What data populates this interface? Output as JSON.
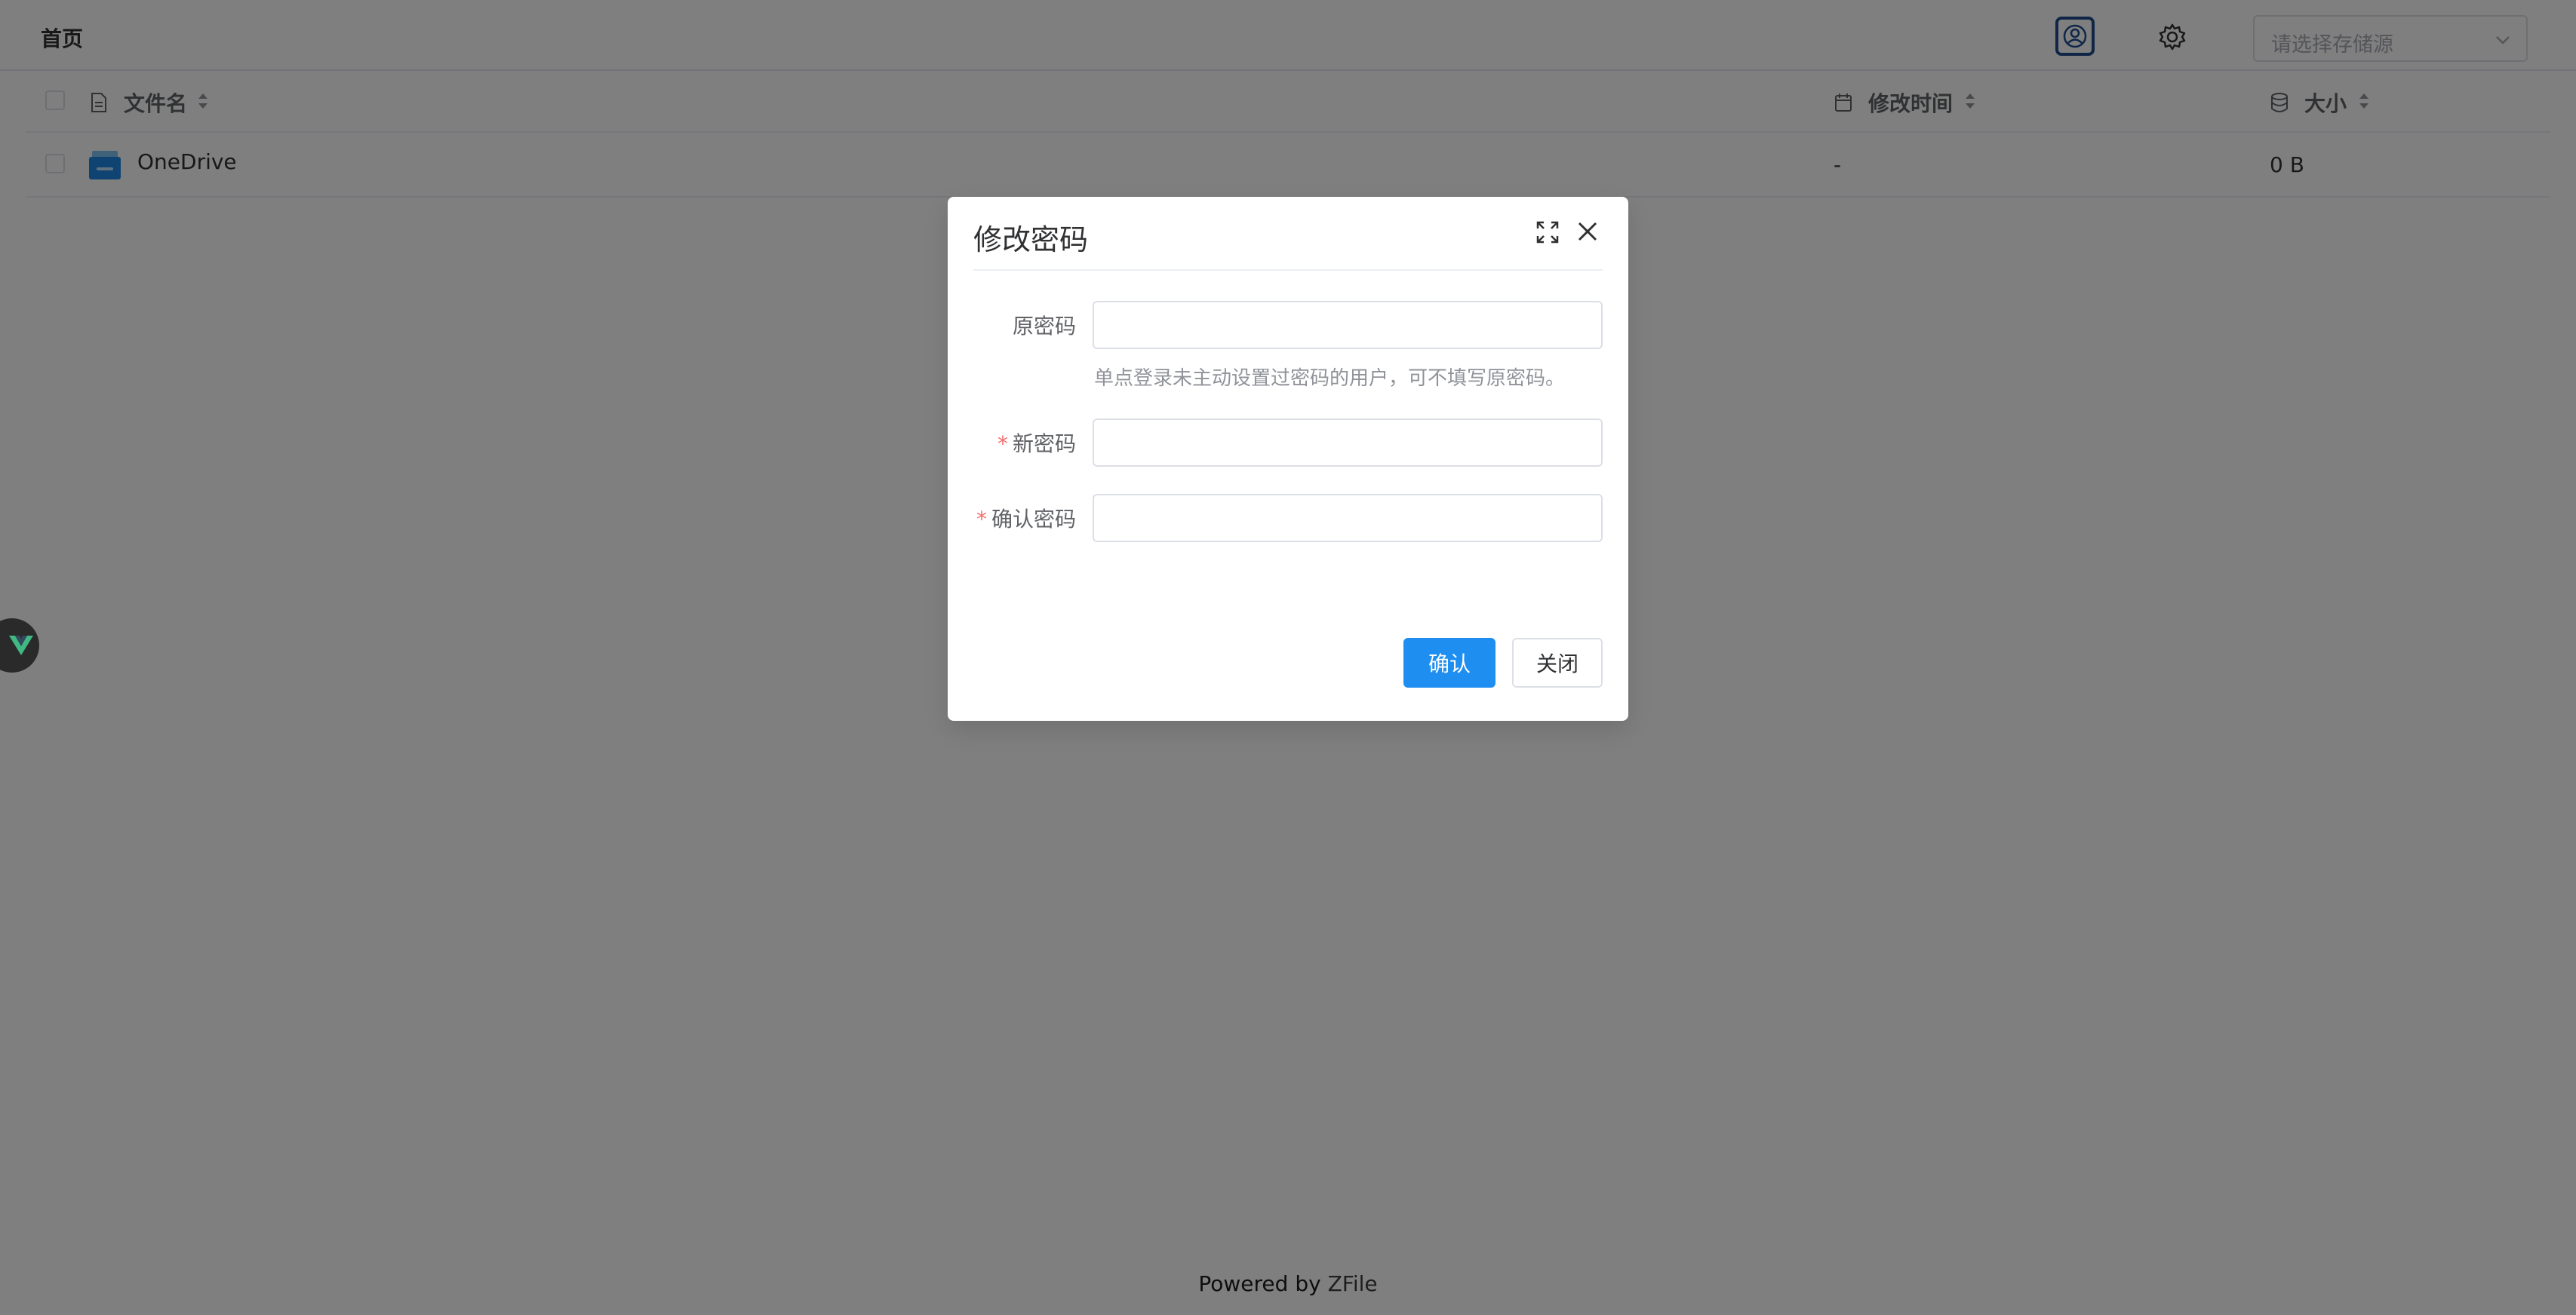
{
  "header": {
    "breadcrumb": "首页",
    "storage_select_placeholder": "请选择存储源"
  },
  "table": {
    "columns": {
      "name": "文件名",
      "modified": "修改时间",
      "size": "大小"
    },
    "rows": [
      {
        "name": "OneDrive",
        "modified": "-",
        "size": "0 B"
      }
    ]
  },
  "dialog": {
    "title": "修改密码",
    "fields": {
      "old_password": {
        "label": "原密码",
        "hint": "单点登录未主动设置过密码的用户，可不填写原密码。"
      },
      "new_password": {
        "label": "新密码",
        "required_mark": "*"
      },
      "confirm_password": {
        "label": "确认密码",
        "required_mark": "*"
      }
    },
    "confirm_label": "确认",
    "close_label": "关闭"
  },
  "footer": {
    "prefix": "Powered by",
    "brand": "ZFile"
  },
  "colors": {
    "primary": "#1f8ef1",
    "required": "#f56c6c",
    "overlay": "rgba(0,0,0,0.5)"
  },
  "icons": [
    "user-icon",
    "gear-icon",
    "chevron-down-icon",
    "file-icon",
    "calendar-icon",
    "database-icon",
    "sort-icon",
    "drive-icon",
    "fullscreen-icon",
    "close-icon",
    "vue-devtools-icon"
  ]
}
